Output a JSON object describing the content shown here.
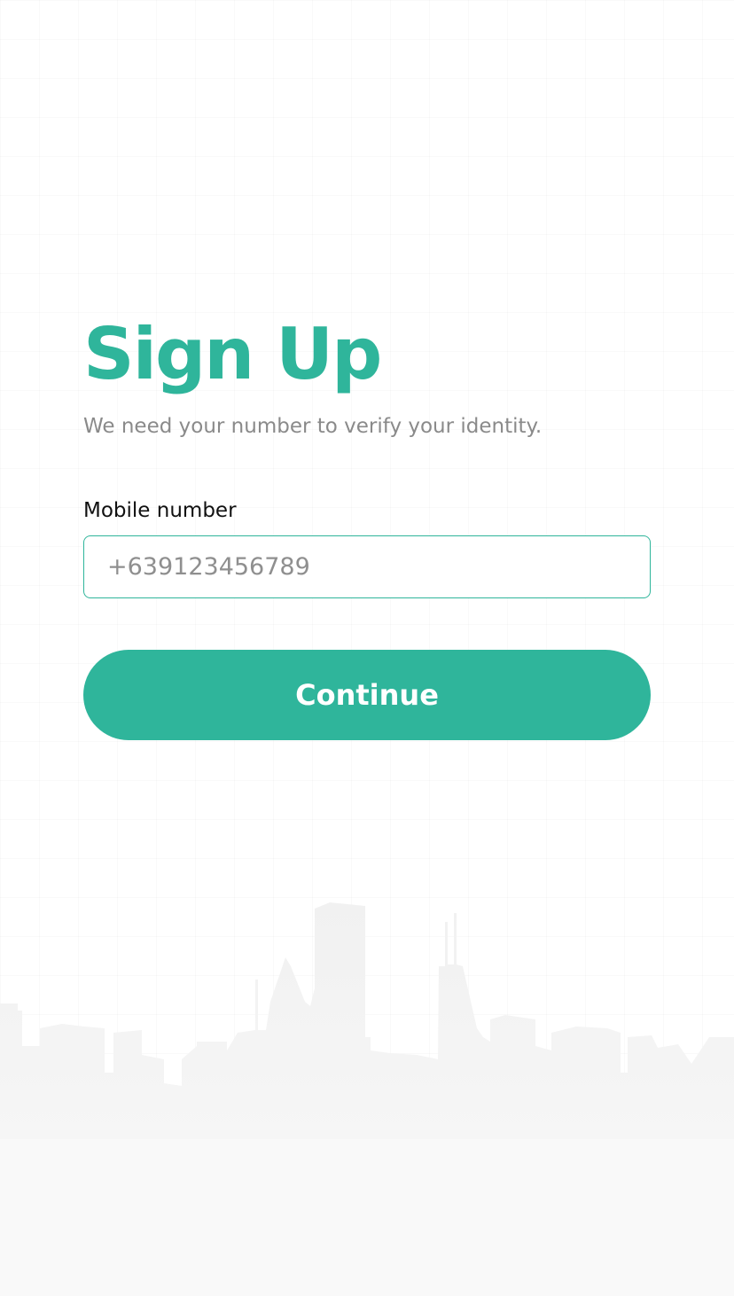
{
  "signup": {
    "title": "Sign Up",
    "subtitle": "We need your number to verify your identity.",
    "mobile_label": "Mobile number",
    "mobile_placeholder": "+639123456789",
    "mobile_value": "",
    "continue_label": "Continue"
  },
  "colors": {
    "accent": "#2fb59b",
    "subtitle_text": "#8a8a8a",
    "placeholder_text": "#8f8f8f",
    "background": "#ffffff",
    "skyline": "#f3f3f3"
  },
  "decor": {
    "background_illustration": "city-skyline"
  }
}
